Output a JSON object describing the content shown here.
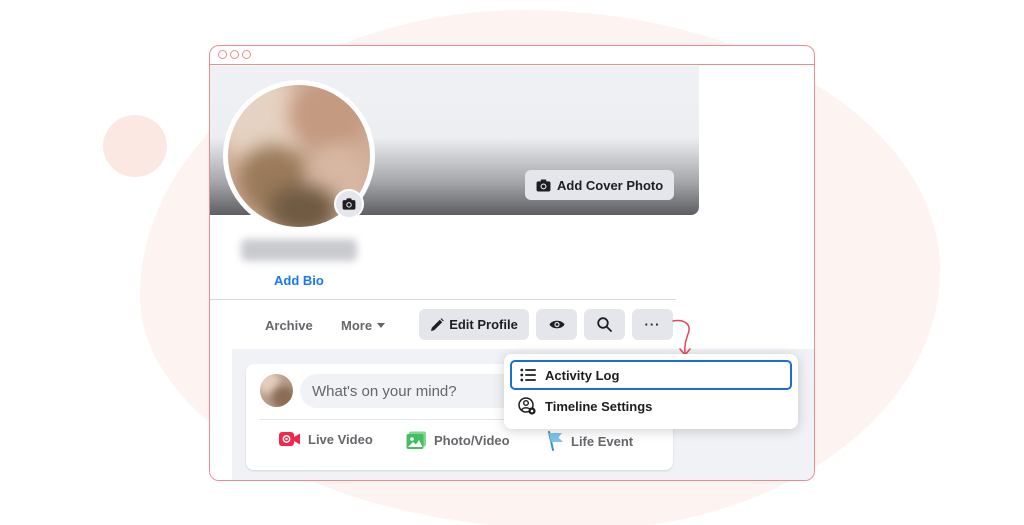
{
  "colors": {
    "window_outline": "#f08a8e",
    "link_blue": "#1877f2",
    "button_gray": "#e4e6eb",
    "feed_bg": "#f0f2f5",
    "focus_outline": "#1d6fcf",
    "live_video_red": "#f02849",
    "photo_green": "#45bd62",
    "life_event_blue": "#3b8fcf"
  },
  "cover": {
    "add_cover_label": "Add Cover Photo"
  },
  "profile": {
    "add_bio_label": "Add Bio"
  },
  "tabs": {
    "archive_label": "Archive",
    "more_label": "More"
  },
  "actions": {
    "edit_profile_label": "Edit Profile",
    "more_options_label": "···"
  },
  "composer": {
    "placeholder": "What's on your mind?",
    "live_video_label": "Live Video",
    "photo_video_label": "Photo/Video",
    "life_event_label": "Life Event"
  },
  "menu": {
    "activity_log_label": "Activity Log",
    "timeline_settings_label": "Timeline Settings"
  },
  "icons": {
    "camera": "camera-icon",
    "pencil": "pencil-icon",
    "eye": "eye-icon",
    "search": "search-icon",
    "list": "list-icon",
    "user_gear": "user-gear-icon",
    "video": "live-video-icon",
    "photo": "photo-icon",
    "flag": "flag-icon"
  }
}
